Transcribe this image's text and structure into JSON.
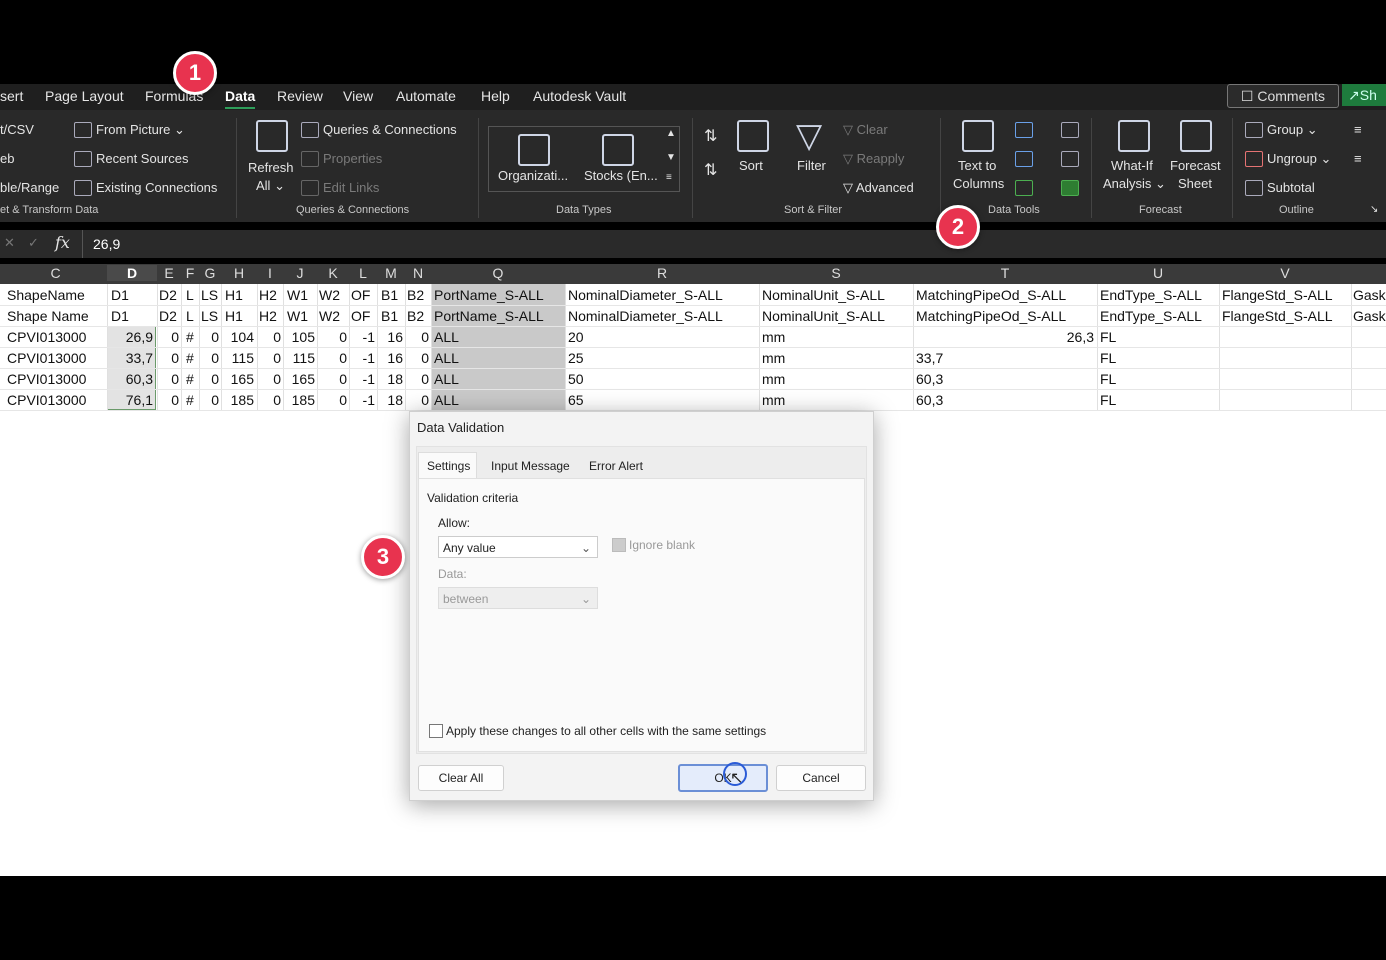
{
  "tabs": [
    "sert",
    "Page Layout",
    "Formulas",
    "Data",
    "Review",
    "View",
    "Automate",
    "Help",
    "Autodesk Vault"
  ],
  "active_tab": "Data",
  "top_right": {
    "comments": "Comments",
    "share": "Sh"
  },
  "ribbon": {
    "get_data": {
      "from_text": "t/CSV",
      "web": "eb",
      "table": "ble/Range",
      "group": "et & Transform Data",
      "from_picture": "From Picture",
      "recent": "Recent Sources",
      "existing": "Existing Connections"
    },
    "queries": {
      "refresh": "Refresh",
      "refresh_all": "All",
      "qc": "Queries & Connections",
      "properties": "Properties",
      "edit_links": "Edit Links",
      "group": "Queries & Connections"
    },
    "data_types": {
      "org": "Organizati...",
      "stocks": "Stocks (En...",
      "group": "Data Types"
    },
    "sort_filter": {
      "sort": "Sort",
      "filter": "Filter",
      "clear": "Clear",
      "reapply": "Reapply",
      "advanced": "Advanced",
      "group": "Sort & Filter"
    },
    "data_tools": {
      "text_to": "Text to",
      "columns": "Columns",
      "group": "Data Tools"
    },
    "forecast": {
      "whatif": "What-If",
      "analysis": "Analysis",
      "forecast": "Forecast",
      "sheet": "Sheet",
      "group": "Forecast"
    },
    "outline": {
      "group_btn": "Group",
      "ungroup": "Ungroup",
      "subtotal": "Subtotal",
      "group": "Outline"
    }
  },
  "formula_bar": {
    "value": "26,9",
    "fx": "fx"
  },
  "columns": [
    "C",
    "D",
    "E",
    "F",
    "G",
    "H",
    "I",
    "J",
    "K",
    "L",
    "M",
    "N",
    "Q",
    "R",
    "S",
    "T",
    "U",
    "V"
  ],
  "rows": [
    [
      "ShapeName",
      "D1",
      "D2",
      "L",
      "LS",
      "H1",
      "H2",
      "W1",
      "W2",
      "OF",
      "B1",
      "B2",
      "PortName_S-ALL",
      "NominalDiameter_S-ALL",
      "NominalUnit_S-ALL",
      "MatchingPipeOd_S-ALL",
      "EndType_S-ALL",
      "FlangeStd_S-ALL",
      "Gask"
    ],
    [
      "Shape Name",
      "D1",
      "D2",
      "L",
      "LS",
      "H1",
      "H2",
      "W1",
      "W2",
      "OF",
      "B1",
      "B2",
      "PortName_S-ALL",
      "NominalDiameter_S-ALL",
      "NominalUnit_S-ALL",
      "MatchingPipeOd_S-ALL",
      "EndType_S-ALL",
      "FlangeStd_S-ALL",
      "Gask"
    ],
    [
      "CPVI013000",
      "26,9",
      "0",
      "#",
      "0",
      "104",
      "0",
      "105",
      "0",
      "-1",
      "16",
      "0",
      "ALL",
      "20",
      "mm",
      "26,3",
      "FL",
      "",
      ""
    ],
    [
      "CPVI013000",
      "33,7",
      "0",
      "#",
      "0",
      "115",
      "0",
      "115",
      "0",
      "-1",
      "16",
      "0",
      "ALL",
      "25",
      "mm",
      "33,7",
      "FL",
      "",
      ""
    ],
    [
      "CPVI013000",
      "60,3",
      "0",
      "#",
      "0",
      "165",
      "0",
      "165",
      "0",
      "-1",
      "18",
      "0",
      "ALL",
      "50",
      "mm",
      "60,3",
      "FL",
      "",
      ""
    ],
    [
      "CPVI013000",
      "76,1",
      "0",
      "#",
      "0",
      "185",
      "0",
      "185",
      "0",
      "-1",
      "18",
      "0",
      "ALL",
      "65",
      "mm",
      "60,3",
      "FL",
      "",
      ""
    ]
  ],
  "dialog": {
    "title": "Data Validation",
    "tabs": [
      "Settings",
      "Input Message",
      "Error Alert"
    ],
    "criteria": "Validation criteria",
    "allow_label": "Allow:",
    "allow_value": "Any value",
    "ignore_blank": "Ignore blank",
    "data_label": "Data:",
    "data_value": "between",
    "apply_all": "Apply these changes to all other cells with the same settings",
    "clear_all": "Clear All",
    "ok": "OK",
    "cancel": "Cancel"
  },
  "badges": [
    "1",
    "2",
    "3"
  ],
  "colors": {
    "accent": "#2e9e5a",
    "badge": "#e8334f",
    "selection": "#d9d9d9"
  }
}
